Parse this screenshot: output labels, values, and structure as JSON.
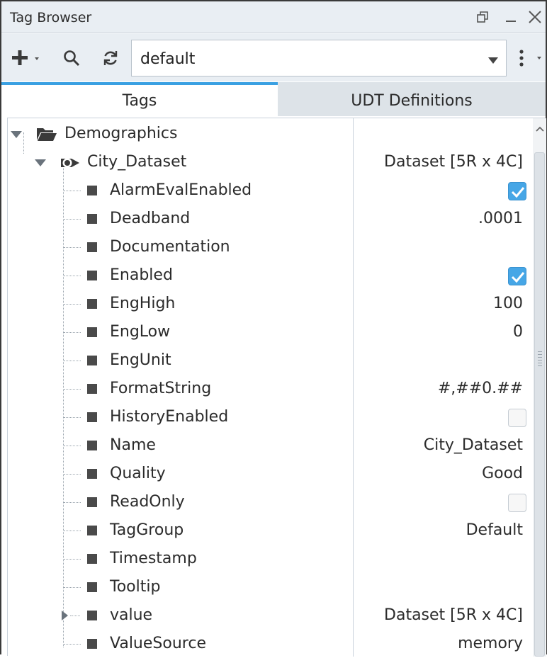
{
  "window": {
    "title": "Tag Browser"
  },
  "toolbar": {
    "add_icon": "plus-icon",
    "search_icon": "search-icon",
    "refresh_icon": "refresh-icon",
    "provider_value": "default",
    "menu_icon": "more-vertical-icon"
  },
  "tabs": [
    {
      "label": "Tags",
      "active": true
    },
    {
      "label": "UDT Definitions",
      "active": false
    }
  ],
  "tree": {
    "folder": {
      "label": "Demographics",
      "icon": "folder-open-icon"
    },
    "tag": {
      "label": "City_Dataset",
      "icon": "dataset-tag-icon",
      "value": "Dataset [5R x 4C]"
    },
    "properties": [
      {
        "label": "AlarmEvalEnabled",
        "value": "",
        "checkbox": true,
        "checked": true
      },
      {
        "label": "Deadband",
        "value": ".0001"
      },
      {
        "label": "Documentation",
        "value": ""
      },
      {
        "label": "Enabled",
        "value": "",
        "checkbox": true,
        "checked": true
      },
      {
        "label": "EngHigh",
        "value": "100"
      },
      {
        "label": "EngLow",
        "value": "0"
      },
      {
        "label": "EngUnit",
        "value": ""
      },
      {
        "label": "FormatString",
        "value": "#,##0.##"
      },
      {
        "label": "HistoryEnabled",
        "value": "",
        "checkbox": true,
        "checked": false
      },
      {
        "label": "Name",
        "value": "City_Dataset"
      },
      {
        "label": "Quality",
        "value": "Good"
      },
      {
        "label": "ReadOnly",
        "value": "",
        "checkbox": true,
        "checked": false
      },
      {
        "label": "TagGroup",
        "value": "Default"
      },
      {
        "label": "Timestamp",
        "value": ""
      },
      {
        "label": "Tooltip",
        "value": ""
      },
      {
        "label": "value",
        "value": "Dataset [5R x 4C]",
        "expandable": true
      },
      {
        "label": "ValueSource",
        "value": "memory"
      }
    ]
  },
  "colors": {
    "accent": "#3aa0e2",
    "checkbox_on": "#46a6e6",
    "header_bg": "#e9eef3",
    "inactive_tab_bg": "#dde3e8"
  }
}
